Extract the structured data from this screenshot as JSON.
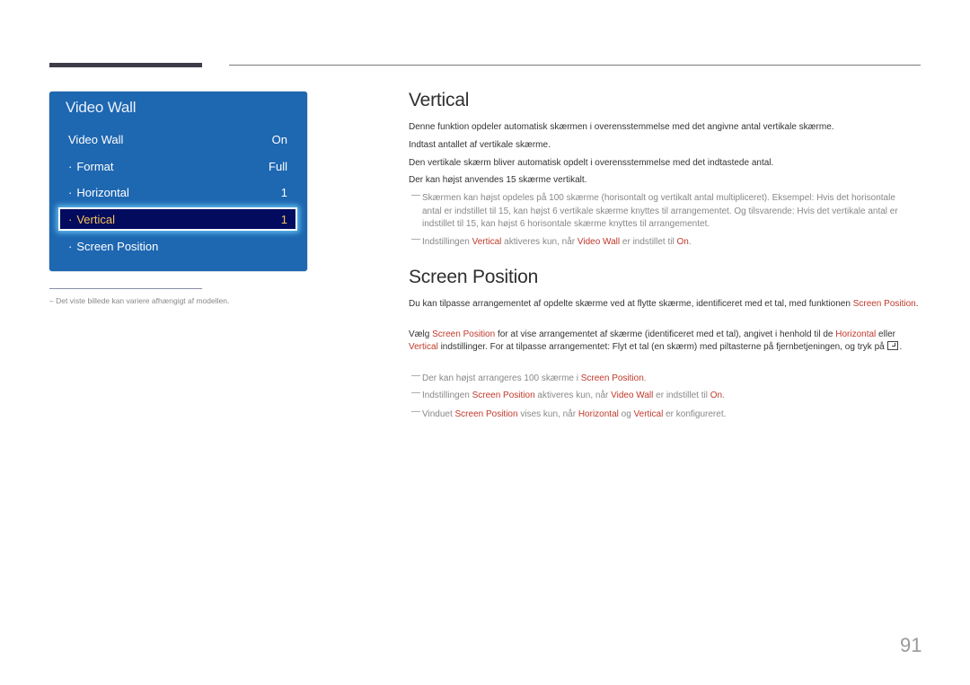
{
  "osd_menu": {
    "title": "Video Wall",
    "items": [
      {
        "label": "Video Wall",
        "value": "On",
        "bullet": ""
      },
      {
        "label": "Format",
        "value": "Full",
        "bullet": "·"
      },
      {
        "label": "Horizontal",
        "value": "1",
        "bullet": "·"
      },
      {
        "label": "Vertical",
        "value": "1",
        "bullet": "·",
        "selected": true
      },
      {
        "label": "Screen Position",
        "value": "",
        "bullet": "·"
      }
    ]
  },
  "footnote": "–  Det viste billede kan variere afhængigt af modellen.",
  "section_vertical": {
    "heading": "Vertical",
    "paragraphs": [
      "Denne funktion opdeler automatisk skærmen i overensstemmelse med det angivne antal vertikale skærme.",
      "Indtast antallet af vertikale skærme.",
      "Den vertikale skærm bliver automatisk opdelt i overensstemmelse med det indtastede antal.",
      "Der kan højst anvendes 15 skærme vertikalt."
    ],
    "note1": "Skærmen kan højst opdeles på 100 skærme (horisontalt og vertikalt antal multipliceret). Eksempel: Hvis det horisontale antal er indstillet til 15, kan højst 6 vertikale skærme knyttes til arrangementet. Og tilsvarende: Hvis det vertikale antal er indstillet til 15, kan højst 6 horisontale skærme knyttes til arrangementet.",
    "note2": {
      "pre": "Indstillingen ",
      "hl1": "Vertical",
      "mid1": " aktiveres kun, når ",
      "hl2": "Video Wall",
      "mid2": " er indstillet til ",
      "hl3": "On",
      "post": "."
    }
  },
  "section_screen_position": {
    "heading": "Screen Position",
    "p1": {
      "pre": "Du kan tilpasse arrangementet af opdelte skærme ved at flytte skærme, identificeret med et tal, med funktionen ",
      "hl1": "Screen Position",
      "post": "."
    },
    "p2": {
      "pre": "Vælg ",
      "hl1": "Screen Position",
      "mid1": " for at vise arrangementet af skærme (identificeret med et tal), angivet i henhold til de ",
      "hl2": "Horizontal",
      "mid2": " eller ",
      "hl3": "Vertical",
      "mid3": " indstillinger. For at tilpasse arrangementet: Flyt et tal (en skærm) med piltasterne på fjernbetjeningen, og tryk på ",
      "post": "."
    },
    "note1": {
      "pre": "Der kan højst arrangeres 100 skærme i ",
      "hl1": "Screen Position",
      "post": "."
    },
    "note2": {
      "pre": "Indstillingen ",
      "hl1": "Screen Position",
      "mid1": " aktiveres kun, når ",
      "hl2": "Video Wall",
      "mid2": " er indstillet til ",
      "hl3": "On",
      "post": "."
    },
    "note3": {
      "pre": "Vinduet ",
      "hl1": "Screen Position",
      "mid1": " vises kun, når ",
      "hl2": "Horizontal",
      "mid2": " og ",
      "hl3": "Vertical",
      "post": " er konfigureret."
    }
  },
  "note_dash": "—",
  "page_number": "91"
}
